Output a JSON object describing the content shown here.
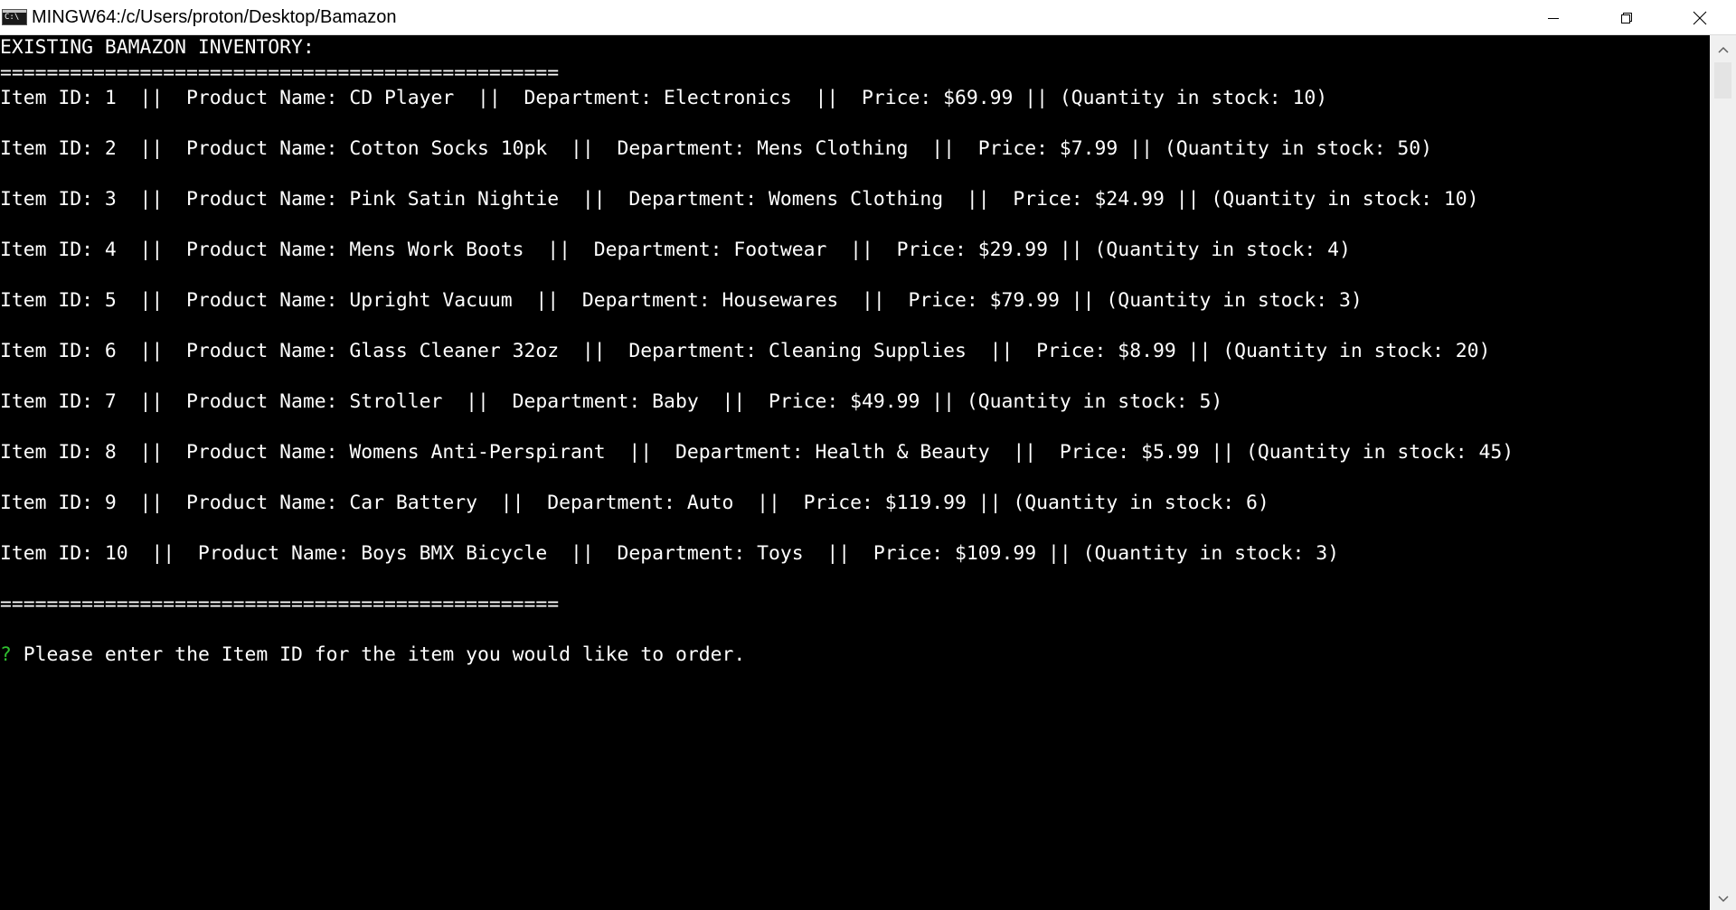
{
  "window": {
    "title": "MINGW64:/c/Users/proton/Desktop/Bamazon",
    "icon_text": "C:\\"
  },
  "console": {
    "heading": "EXISTING BAMAZON INVENTORY:",
    "separator": "================================================",
    "items": [
      "Item ID: 1  ||  Product Name: CD Player  ||  Department: Electronics  ||  Price: $69.99 || (Quantity in stock: 10)",
      "Item ID: 2  ||  Product Name: Cotton Socks 10pk  ||  Department: Mens Clothing  ||  Price: $7.99 || (Quantity in stock: 50)",
      "Item ID: 3  ||  Product Name: Pink Satin Nightie  ||  Department: Womens Clothing  ||  Price: $24.99 || (Quantity in stock: 10)",
      "Item ID: 4  ||  Product Name: Mens Work Boots  ||  Department: Footwear  ||  Price: $29.99 || (Quantity in stock: 4)",
      "Item ID: 5  ||  Product Name: Upright Vacuum  ||  Department: Housewares  ||  Price: $79.99 || (Quantity in stock: 3)",
      "Item ID: 6  ||  Product Name: Glass Cleaner 32oz  ||  Department: Cleaning Supplies  ||  Price: $8.99 || (Quantity in stock: 20)",
      "Item ID: 7  ||  Product Name: Stroller  ||  Department: Baby  ||  Price: $49.99 || (Quantity in stock: 5)",
      "Item ID: 8  ||  Product Name: Womens Anti-Perspirant  ||  Department: Health & Beauty  ||  Price: $5.99 || (Quantity in stock: 45)",
      "Item ID: 9  ||  Product Name: Car Battery  ||  Department: Auto  ||  Price: $119.99 || (Quantity in stock: 6)",
      "Item ID: 10  ||  Product Name: Boys BMX Bicycle  ||  Department: Toys  ||  Price: $109.99 || (Quantity in stock: 3)"
    ],
    "separator_bottom": "================================================",
    "prompt_mark": "?",
    "prompt_text": " Please enter the Item ID for the item you would like to order."
  },
  "colors": {
    "background": "#000000",
    "text": "#ffffff",
    "prompt_mark": "#2fbf2f"
  },
  "icons": {
    "minimize": "minimize-icon",
    "restore": "restore-icon",
    "close": "close-icon",
    "scroll_up": "chevron-up-icon",
    "scroll_down": "chevron-down-icon"
  }
}
